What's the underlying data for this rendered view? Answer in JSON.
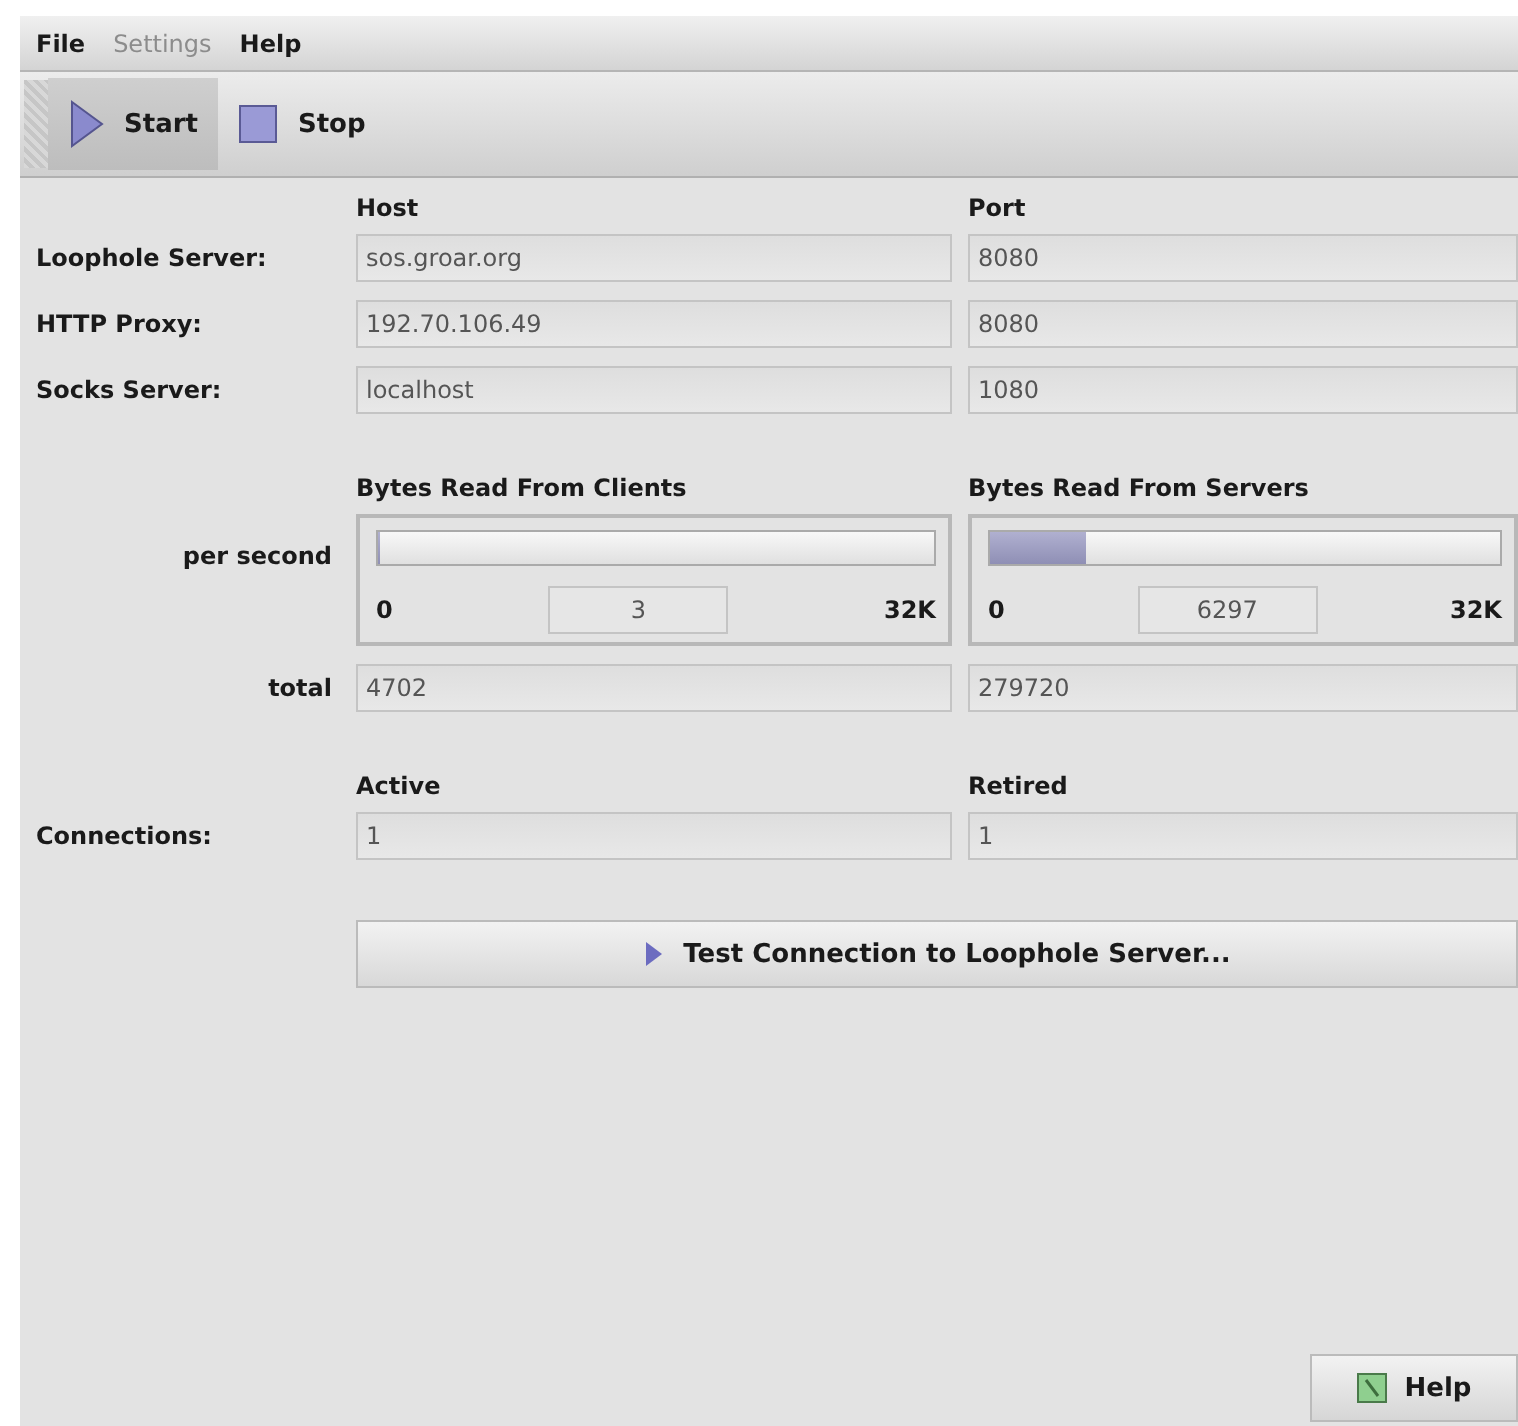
{
  "menu": [
    {
      "label": "File",
      "disabled": false
    },
    {
      "label": "Settings",
      "disabled": true
    },
    {
      "label": "Help",
      "disabled": false
    }
  ],
  "toolbar": [
    {
      "label": "Start",
      "kind": "play",
      "selected": true
    },
    {
      "label": "Stop",
      "kind": "stop",
      "selected": false
    }
  ],
  "servers": {
    "columns": [
      "Host",
      "Port"
    ],
    "rows": [
      {
        "label": "Loophole Server:",
        "host": "sos.groar.org",
        "port": "8080"
      },
      {
        "label": "HTTP Proxy:",
        "host": "192.70.106.49",
        "port": "8080"
      },
      {
        "label": "Socks Server:",
        "host": "localhost",
        "port": "1080"
      }
    ]
  },
  "traffic": {
    "per_second_label": "per second",
    "total_label": "total",
    "meters": [
      {
        "title": "Bytes Read From Clients",
        "min": "0",
        "max": "32K",
        "reading": "3",
        "level": 0.0001,
        "total": "4702"
      },
      {
        "title": "Bytes Read From Servers",
        "min": "0",
        "max": "32K",
        "reading": "6297",
        "level": 0.19,
        "total": "279720"
      }
    ]
  },
  "connections": {
    "label": "Connections:",
    "columns": [
      "Active",
      "Retired"
    ],
    "values": [
      "1",
      "1"
    ]
  },
  "test_button": "Test Connection to Loophole Server...",
  "help_button": "Help"
}
